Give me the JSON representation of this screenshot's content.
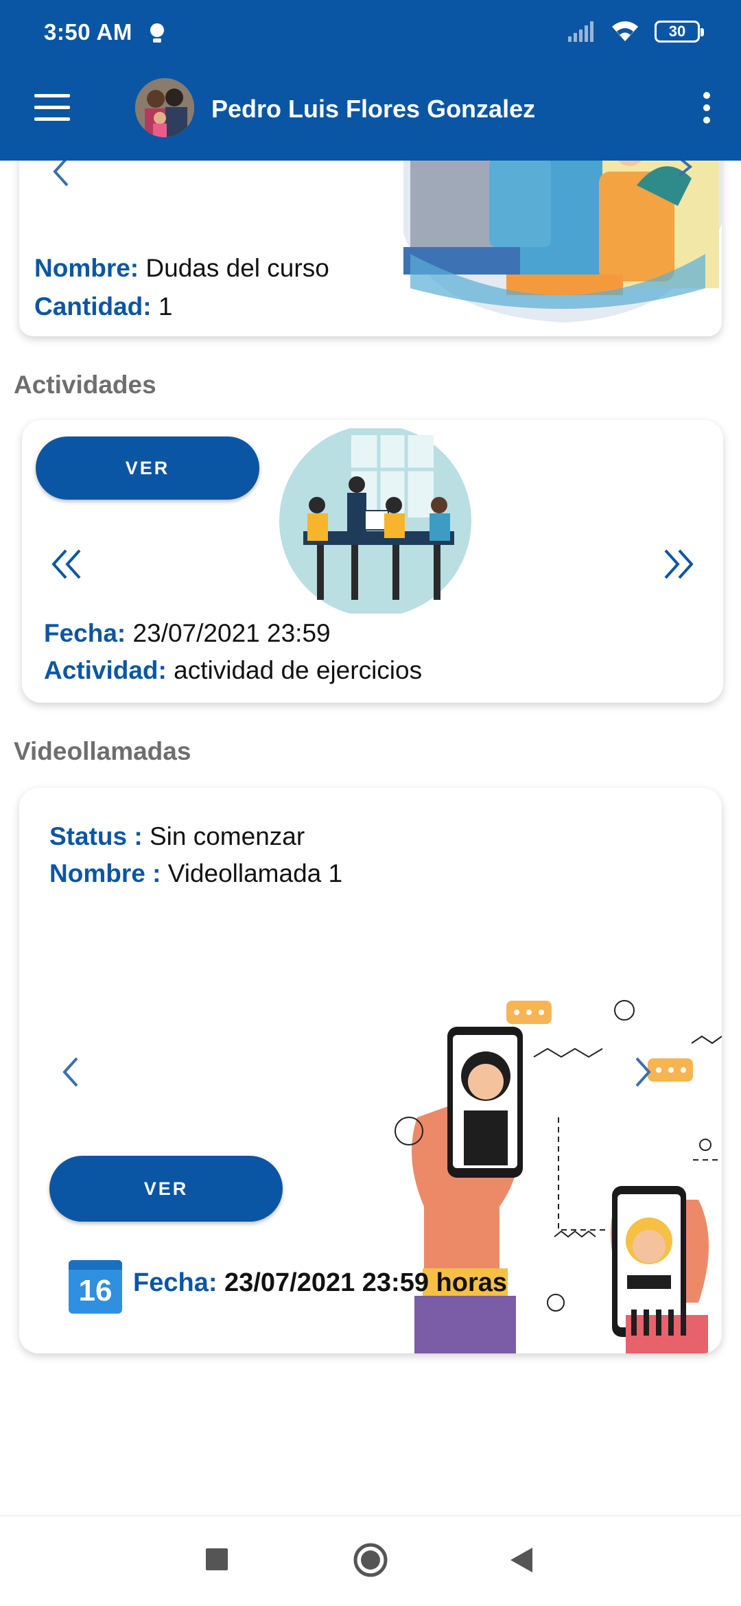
{
  "status_bar": {
    "time": "3:50 AM",
    "battery": "30"
  },
  "app_bar": {
    "title": "Pedro Luis Flores Gonzalez"
  },
  "foros_card": {
    "nombre_label": "Nombre:",
    "nombre_value": "Dudas del curso",
    "cantidad_label": "Cantidad:",
    "cantidad_value": "1"
  },
  "actividades": {
    "section_title": "Actividades",
    "ver_label": "VER",
    "fecha_label": "Fecha:",
    "fecha_value": "23/07/2021 23:59",
    "actividad_label": "Actividad:",
    "actividad_value": "actividad de ejercicios",
    "prev_glyph": "«",
    "next_glyph": "»"
  },
  "videollamadas": {
    "section_title": "Videollamadas",
    "status_label": "Status :",
    "status_value": "Sin comenzar",
    "nombre_label": "Nombre :",
    "nombre_value": "Videollamada 1",
    "ver_label": "VER",
    "calendar_day": "16",
    "fecha_label": "Fecha:",
    "fecha_value": "23/07/2021 23:59 horas"
  },
  "colors": {
    "primary": "#0b56a4",
    "section_title": "#6e6e6e"
  },
  "icons": [
    "menu-icon",
    "kebab-menu-icon",
    "chevron-left-icon",
    "chevron-right-icon",
    "double-chevron-left-icon",
    "double-chevron-right-icon",
    "calendar-icon",
    "nav-square-icon",
    "nav-circle-icon",
    "nav-triangle-icon"
  ]
}
